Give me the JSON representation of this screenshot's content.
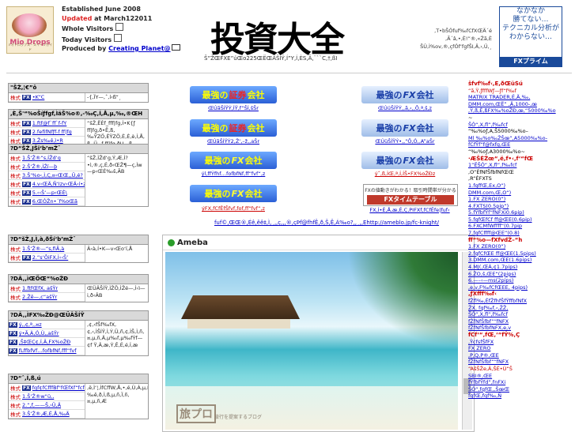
{
  "header": {
    "logo_title": "Mio Drops",
    "logo_sub": "ミオドロップス・スイーツガイド",
    "established_label": "Established",
    "established_value": "June 2008",
    "updated_label": "Updated",
    "updated_mid": "at",
    "updated_value": "March122011",
    "whole_visitors": "Whole Visitors",
    "today_visitors": "Today Visitors",
    "produced_by": "Produced by",
    "producer_link": "Creating Planet@",
    "site_title": "投資大全",
    "title_caption": "Š”ŽŒFXE”úŒo225ŒËŒÄŠÍŸ,Í”Y,Í,ÈS,Ã,¨``C,†,ßI",
    "right_garble": [
      ",T•bŠÓfuf‰fCfXŒÄ´é",
      ",Ã´â,•,È!”®,«Žã,È",
      "ŠÙ,Ì%ov,®,çfÓf‘fgfŠI,Ä,›,Ú,¸"
    ],
    "banner_lines": [
      "なかなか",
      "勝てない…",
      "テクニカル分析が",
      "わからない…"
    ],
    "banner_bar": "FXプライム"
  },
  "left_sections": [
    {
      "title": "\"ŠŽ,¦€”ô",
      "rows": [
        {
          "tag": "株式",
          "fx": "FX",
          "link": "•K“C"
        }
      ],
      "side": "-{,ÏY—,ˆ,í‹ß“¸"
    },
    {
      "title": ",È,Š'“%oŠíƒfgf,ÌãŠ%o®,-‰Ç,Í,Å,µ,‰,®ŒH",
      "rows": [
        {
          "tag": "株式",
          "fx": "FX",
          "link": "1.ftf@f`ff`f-fY"
        },
        {
          "tag": "株式",
          "fx": "FX",
          "link": "2.fefifNfƒf-f ff|fg"
        },
        {
          "tag": "株式",
          "fx": "FX",
          "link": "3.Žs‰ê,ì•R"
        },
        {
          "tag": "株式",
          "fx": "FX",
          "link": "4.o—“,"
        }
      ],
      "side": "“šŽ‚ËÈf_fff|fg,Ì•K{ƒ ff|fg,ð•Ë,ß,‰ŸZÖ,ÈŸZÖ,È,È,è,Ì,Å, ß ,Ü,¸f ff|fg,ðU—ß"
    },
    {
      "title": "?D“ŠŽ‚JŠi‘b’mŽ¯",
      "rows": [
        {
          "tag": "株式",
          "fx": "",
          "link": "1.Š‘Ž®“s,ÍŽd‘g"
        },
        {
          "tag": "株式",
          "fx": "",
          "link": "2.Š‘Ž®,ÌŽí—þ"
        },
        {
          "tag": "株式",
          "fx": "",
          "link": "3.Š‘%o‹,Ì,Ç‚¤‹ŒŒ‚,Ü,é?"
        },
        {
          "tag": "株式",
          "fx": "FX",
          "link": "4.v‹ŒÄ,Ñ‘Izv‹ŒÄ‹í•z"
        },
        {
          "tag": "株式",
          "fx": "FX",
          "link": "5.‹‹Š‘—p‹ŒÉ\\"
        },
        {
          "tag": "株式",
          "fx": "FX",
          "link": "6.ŒÓŽn•´f%oŒã"
        }
      ],
      "side": "“šŽ‚ÌŽd‘g,Ý,Æ,Ì?•ì,®,ç,É,ð‹ŒŽ¶—ç,Ìw—p‹ŒÉ‰š,ÃB"
    },
    {
      "title": "?D“šŽ‚J‚Ì,à‚ðŠí‘b’mŽ¯",
      "rows": [
        {
          "tag": "株式",
          "fx": "",
          "link": "1.Š‘Ž®—“s‚fiÃ‚à"
        },
        {
          "tag": "株式",
          "fx": "FX",
          "link": "2.“s‘ÔiFX,Ì‹‹Š‘"
        }
      ],
      "side": "Â‹à,Í•K—v‹Œo‘í,Å"
    },
    {
      "title": "?DÂ‚,ìŒÖŒ“%oŽÐ",
      "rows": [
        {
          "tag": "株式",
          "fx": "",
          "link": "1.ftfŒfX‚ ašŸr"
        },
        {
          "tag": "株式",
          "fx": "",
          "link": "2.Žê—‚c“ašŸr"
        }
      ],
      "side": "ŒÜÂŠÍŸ,ÌŽÖ,ÌŽé—,Ì‹ì—i,ð‹ÂB"
    },
    {
      "title": "?DÂ‚,ÌFX‰ŽÐ@ŒÜÂŠÍŸ",
      "rows": [
        {
          "tag": "",
          "fx": "FX",
          "link": "ý,‚¢,ª,‚¤z"
        },
        {
          "tag": "",
          "fx": "FX",
          "link": "ý•Ã,À‚Ó,Ù,‚ašŸr"
        },
        {
          "tag": "",
          "fx": "FX",
          "link": "‚Š‡ŒÇ¢,Í,Â‚FX%oŽÐ"
        },
        {
          "tag": "",
          "fx": "FX",
          "link": "fLffbfVf…fofbfNf‚fff“fvf"
        }
      ],
      "side": ",¢,‹fŠf‰fX,¢,‹,ÌŠÍŸ,Ì,Ý,Ü,ñ,¢,ÌŠ,Ì,ñ,¤,µ,ñ,Ä,µ‰f,µ‰fÝf—¢f Ÿ,Â,æ,Ý,Ê,É,é,Í,æ"
    },
    {
      "title": "?D“ˆ,Í,ß‚ú",
      "rows": [
        {
          "tag": "株式",
          "fx": "FX",
          "link": "fqf¢fCfffBf\"fŒfXf“fcf‹"
        },
        {
          "tag": "株式",
          "fx": "",
          "link": "1.Š‘Ž®w“ü,‚"
        },
        {
          "tag": "株式",
          "fx": "",
          "link": "2.“‚f‚——Š,›Ü,Ä"
        },
        {
          "tag": "株式",
          "fx": "",
          "link": "3.Š‘Ž®,Æ,É,Å,‰Ä"
        }
      ],
      "side": "‚ë,Ì‘¦,ÌfCffW,Å,•,é,Ù,À,µ,ß,Ä,Í,‰ê,ð,Ì,ß,µ,ñ,Ï‚ñ,¤,µ,ñ,Æ"
    }
  ],
  "center": {
    "banner_text_a": "最強の",
    "banner_text_b": "会社",
    "banner_stock": "証券",
    "banner_fx": "FX",
    "captions": [
      "ŒÚãŠÍŸÝ,ÍŸ,f“ŠÍ‚šŠr",
      "ŒÚüŠÍŸÝ,‚ã,‹‚‚Ô,ª,š‚z",
      "ŒÚãŠÍŸÝ2,Ž‘‚–ž‚‚aŠr",
      "ŒÚüŠÍŸÝ•‚,“Ô‚Ó,‚A”aŠr",
      "ýl,ffÝfhf…fofbfNf‚ff“fvf“‚z",
      "ýˆ‚ß,ÌŒ‚ª,Í,ÍŠ•FX%oŽÐz",
      "ýFX‚fCfÊfŠfvf‚fof‚ff“fvf“‚z",
      "FX,Í•È,Å‚æ,É‚Ç,PIFXf‚fCfÊfe|fuf‹"
    ],
    "timetable_top": "FXの値動きがわかる！取引時間帯が分かる",
    "timetable_mid": "FXタイムテーブル",
    "mid_link": "fuf©,ŒŒ®,Éê,êê‡,Ì,¸‚,ç,‚,®,çÞf@fhfÊ,ð‚Š,Ê,Á‰o?,‚¸‚‚Ehttp://ameblo.jp/fc-knight/",
    "ameba_name": "Ameba",
    "photo_logo": "旅プロ",
    "photo_slogan": "旅行を提案するブログ"
  },
  "right_col": [
    {
      "s": "h",
      "t": "šfvf‰f‹,È,ðŒüŠú"
    },
    {
      "s": "r",
      "t": "“ã‚Ÿ‚ƒfffWƒ—ƒf“f‰f"
    },
    {
      "s": "a",
      "t": "MATRIX TRADER,É‚Ä‚‰,"
    },
    {
      "s": "a",
      "t": "DMM.com‚ŒË” ‚Ä‚1000-‚œ"
    },
    {
      "s": "a",
      "t": ",Ÿ,ß,È,ßFX‰%oŽÐ‚œ‚“5000‰%o"
    },
    {
      "s": "",
      "t": "~"
    },
    {
      "s": "a",
      "t": "ŠÓ“‚X‚fl“‚f‰fcf"
    },
    {
      "s": "",
      "t": "“‰%oƒ‚A,Š5000‰%o–"
    },
    {
      "s": "a",
      "t": "Ml ‰%o‰ŽŠœ“‚A5000‰%o-"
    },
    {
      "s": "a",
      "t": "fCfŸf“f@fxfg‚ŒE"
    },
    {
      "s": "",
      "t": "“‰%oƒ‚A3000‰%o~"
    },
    {
      "s": "h",
      "t": "·ÆŠÉŽœ“‚ë,f•‹‚f‘“fŒ"
    },
    {
      "s": "a",
      "t": "1“ËŠÓ“‚X‚fl“‚f‰fcf"
    },
    {
      "s": "",
      "t": ",O“ÈfNfŠfbfNfŒŒ"
    },
    {
      "s": "",
      "t": ",R“ÈFXTS"
    },
    {
      "s": "a",
      "t": "1.fqffŒ‚Ex‚O“)"
    },
    {
      "s": "a",
      "t": "DMM.com‚Œ‚O“)"
    },
    {
      "s": "a",
      "t": "1.FX ZERO(0“)"
    },
    {
      "s": "a",
      "t": "4.FXTS(0.5pip“)"
    },
    {
      "s": "a",
      "t": "5.fŸfbfŸf“fNFXi0.6pip)"
    },
    {
      "s": "a",
      "t": "5.fqfŒfCf ff@ŒE(0.6pip)"
    },
    {
      "s": "a",
      "t": "6.FXCMfWffff“(0.7pip"
    },
    {
      "s": "a",
      "t": "7.fqfCffff@ŒE“(0.8)"
    },
    {
      "s": "h",
      "t": "ff“%o—fXfvdŽ–“h"
    },
    {
      "s": "a",
      "t": "1.FX ZERO(0“)"
    },
    {
      "s": "a",
      "t": "2.fqfCfŒE ff@ŒE(1.5pips)"
    },
    {
      "s": "a",
      "t": "3.DMM.com‚ŒE(1.6pips)"
    },
    {
      "s": "a",
      "t": "4.MJ(‚ŒÀ‚¢1.7pips)"
    },
    {
      "s": "a",
      "t": "6.ŽO‚š‚ŒE“(2pips)"
    },
    {
      "s": "a",
      "t": "6.—–‹—ms(2pips)"
    },
    {
      "s": "a",
      "t": ",e,v,F‰fCfŒEE‚ 4pips)"
    },
    {
      "s": "h",
      "t": ",ƒXfff‰f‹"
    },
    {
      "s": "a",
      "t": "fŽfl‰‚ÉfŽfhfŠfŸffbfNfX"
    },
    {
      "s": "a",
      "t": "ŽX‚ fqf‰f‚‹‚ŽŽ‚"
    },
    {
      "s": "a",
      "t": "ŠÓ“‚X‚fl“‚f‰fcf"
    },
    {
      "s": "a",
      "t": "fŽfNfŠfbf““fNFX"
    },
    {
      "s": "a",
      "t": "fŽfNfŠfbfNFX,e,v"
    },
    {
      "s": "h",
      "t": "fCf‘“‚fŒ‚‘“fŸ%‚Ç"
    },
    {
      "s": "a",
      "t": "‚ŸcfsfŠfFX"
    },
    {
      "s": "a",
      "t": "FX ZERO"
    },
    {
      "s": "a",
      "t": ",P,Q,P®‚ŒE"
    },
    {
      "s": "a",
      "t": "fŽfNfŠfbf““fNFX"
    },
    {
      "s": "r",
      "t": "“AšŠŽe‚Â‚ŠÉ•Ù“Š"
    },
    {
      "s": "a",
      "t": "SBI®‚ŒE"
    },
    {
      "s": "a",
      "t": "fŸfbfŸfd“‚fnFXi"
    },
    {
      "s": "a",
      "t": "ŠÓ“‚fqfŒ‚‚ŠœŒ"
    },
    {
      "s": "a",
      "t": "fqfŒ‚fqf‰‚Ñ"
    }
  ]
}
